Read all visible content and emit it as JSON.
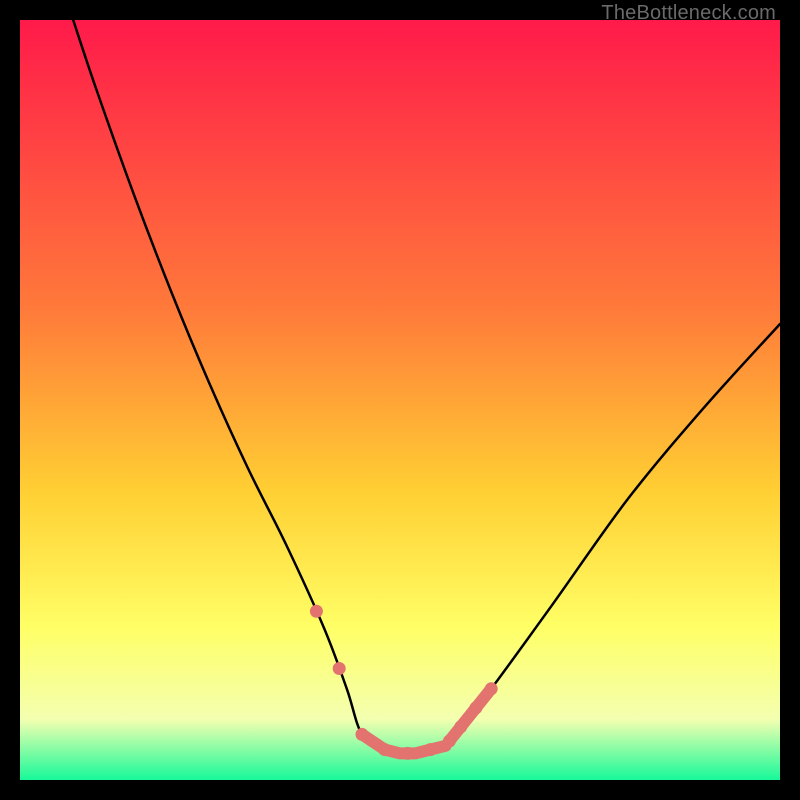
{
  "watermark": "TheBottleneck.com",
  "colors": {
    "black": "#000000",
    "marker": "#e3736f",
    "grad_top": "#ff1a4a",
    "grad_mid1": "#ff7a3a",
    "grad_mid2": "#ffcf33",
    "grad_mid3": "#ffff66",
    "grad_mid4": "#f4ffb0",
    "grad_bot": "#17f99a"
  },
  "chart_data": {
    "type": "line",
    "title": "",
    "xlabel": "",
    "ylabel": "",
    "xlim": [
      0,
      100
    ],
    "ylim": [
      0,
      100
    ],
    "curve": {
      "left_top": {
        "x": 7,
        "y": 100
      },
      "minimum": {
        "x": 50,
        "y": 3.5
      },
      "right_top": {
        "x": 100,
        "y": 60
      }
    },
    "flat_minimum_range_x": [
      45,
      56
    ],
    "markers_x": [
      39,
      42,
      45,
      48,
      51,
      54,
      56.5,
      58,
      60,
      62
    ],
    "series": [
      {
        "name": "bottleneck-curve",
        "x": [
          7,
          10,
          15,
          20,
          25,
          30,
          35,
          40,
          43,
          45,
          48,
          50,
          52,
          54,
          56,
          58,
          62,
          70,
          80,
          90,
          100
        ],
        "y": [
          100,
          91,
          77,
          64,
          52,
          41,
          31,
          20,
          12,
          6,
          4,
          3.5,
          3.5,
          4,
          4.5,
          7,
          12,
          23,
          37,
          49,
          60
        ]
      }
    ]
  }
}
